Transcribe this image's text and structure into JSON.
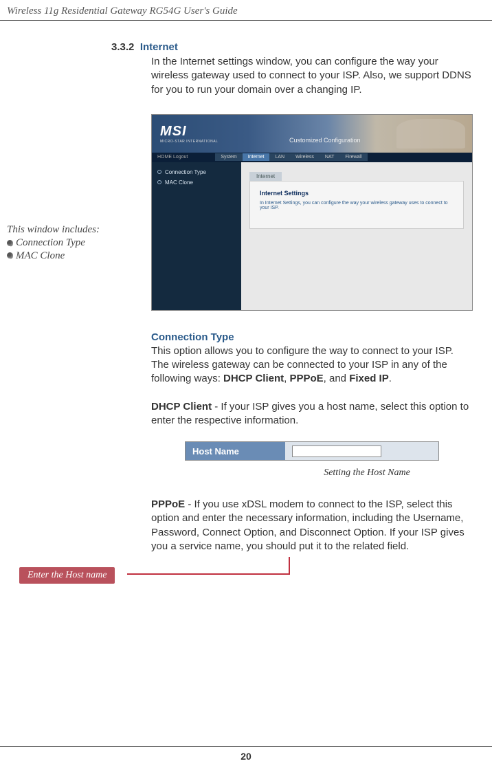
{
  "header": "Wireless 11g Residential Gateway RG54G User's Guide",
  "section": {
    "num": "3.3.2",
    "title": "Internet"
  },
  "intro": "In the Internet settings window, you can configure the way your wireless gateway used to connect to your ISP.  Also, we support DDNS for you to run your domain over a changing IP.",
  "sidebar": {
    "line1": "This window includes:",
    "item1": "Connection Type",
    "item2": "MAC Clone"
  },
  "screenshot": {
    "logo": "MSI",
    "logo_sub": "MICRO-STAR INTERNATIONAL",
    "banner_title": "Customized Configuration",
    "nav_left": "HOME   Logout",
    "tabs": {
      "system": "System",
      "internet": "Internet",
      "lan": "LAN",
      "wireless": "Wireless",
      "nat": "NAT",
      "firewall": "Firewall"
    },
    "side_items": {
      "a": "Connection Type",
      "b": "MAC Clone"
    },
    "panel_tab": "Internet",
    "panel_h": "Internet Settings",
    "panel_p": "In Internet Settings, you can configure the way your wireless gateway uses to connect to your ISP."
  },
  "conn_type": {
    "title": "Connection Type",
    "body_pre": "This option allows you to configure the way to connect to your ISP.  The wireless gateway can be connected to your ISP in any of the following ways: ",
    "b1": "DHCP Client",
    "c1": ", ",
    "b2": "PPPoE",
    "c2": ", and ",
    "b3": "Fixed IP",
    "c3": "."
  },
  "dhcp": {
    "b": "DHCP Client",
    "body": " - If your ISP gives you a host name, select this option to enter the respective information."
  },
  "hostname_label": "Host Name",
  "callout": "Enter the Host name",
  "caption": "Setting the Host Name",
  "pppoe": {
    "b": "PPPoE",
    "body": " - If you use xDSL modem to connect to the ISP, select this option and enter the necessary information, including the Username, Password, Connect Option, and Disconnect Option.  If your ISP gives you a service name, you should put it to the related field."
  },
  "page_num": "20"
}
